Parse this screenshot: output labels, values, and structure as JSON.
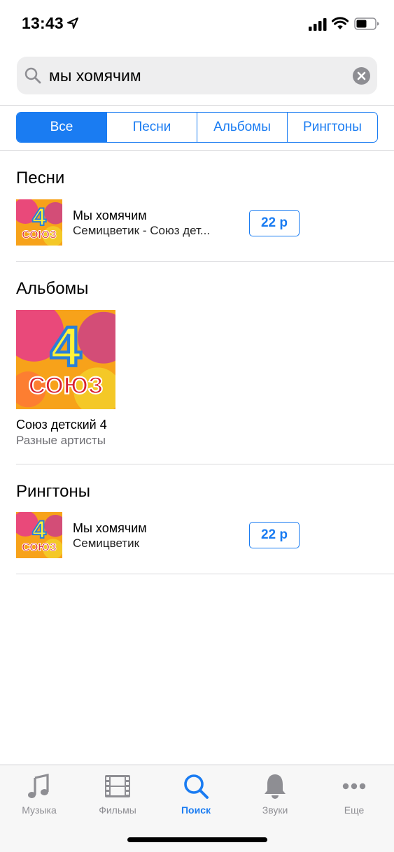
{
  "status_bar": {
    "time": "13:43"
  },
  "search": {
    "query": "мы хомячим"
  },
  "segments": [
    {
      "label": "Все",
      "active": true
    },
    {
      "label": "Песни",
      "active": false
    },
    {
      "label": "Альбомы",
      "active": false
    },
    {
      "label": "Рингтоны",
      "active": false
    }
  ],
  "songs": {
    "title": "Песни",
    "items": [
      {
        "title": "Мы хомячим",
        "subtitle": "Семицветик - Союз дет...",
        "price": "22 р",
        "cover_text": "4",
        "cover_text2": "СОЮЗ"
      }
    ]
  },
  "albums": {
    "title": "Альбомы",
    "items": [
      {
        "title": "Союз детский 4",
        "subtitle": "Разные артисты",
        "cover_text": "4",
        "cover_text2": "СОЮЗ"
      }
    ]
  },
  "ringtones": {
    "title": "Рингтоны",
    "items": [
      {
        "title": "Мы хомячим",
        "subtitle": "Семицветик",
        "price": "22 р",
        "cover_text": "4",
        "cover_text2": "СОЮЗ"
      }
    ]
  },
  "tab_bar": {
    "tabs": [
      {
        "label": "Музыка",
        "icon": "music-note-icon",
        "active": false
      },
      {
        "label": "Фильмы",
        "icon": "film-icon",
        "active": false
      },
      {
        "label": "Поиск",
        "icon": "search-icon",
        "active": true
      },
      {
        "label": "Звуки",
        "icon": "bell-icon",
        "active": false
      },
      {
        "label": "Еще",
        "icon": "more-icon",
        "active": false
      }
    ]
  },
  "colors": {
    "accent": "#1a7cf2",
    "inactive": "#8e8e93",
    "cover_orange": "#f7a21a",
    "cover_pink": "#e63a8c",
    "cover_red": "#d8202f"
  }
}
